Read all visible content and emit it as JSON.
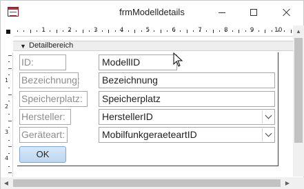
{
  "window": {
    "title": "frmModelldetails"
  },
  "ruler": {
    "numbers": [
      "1",
      "2",
      "3",
      "4",
      "5",
      "6",
      "7",
      "8",
      "9",
      "10"
    ],
    "vertical_numbers": [
      "1",
      "2",
      "3",
      "4"
    ]
  },
  "section": {
    "label": "Detailbereich",
    "arrow_icon": "section-down-arrow-icon"
  },
  "form": {
    "fields": [
      {
        "label": "ID:",
        "value": "ModellID",
        "control": "textbox"
      },
      {
        "label": "Bezeichnung:",
        "value": "Bezeichnung",
        "control": "textbox"
      },
      {
        "label": "Speicherplatz:",
        "value": "Speicherplatz",
        "control": "textbox"
      },
      {
        "label": "Hersteller:",
        "value": "HerstellerID",
        "control": "combobox"
      },
      {
        "label": "Geräteart:",
        "value": "MobilfunkgeraeteartID",
        "control": "combobox"
      }
    ],
    "ok_label": "OK"
  },
  "colors": {
    "label_text": "#8c8c8c",
    "field_text": "#1f1f1f",
    "control_border": "#a6a6a6",
    "ok_button": "#bcd6f0",
    "app_icon_accent": "#a4373a"
  }
}
